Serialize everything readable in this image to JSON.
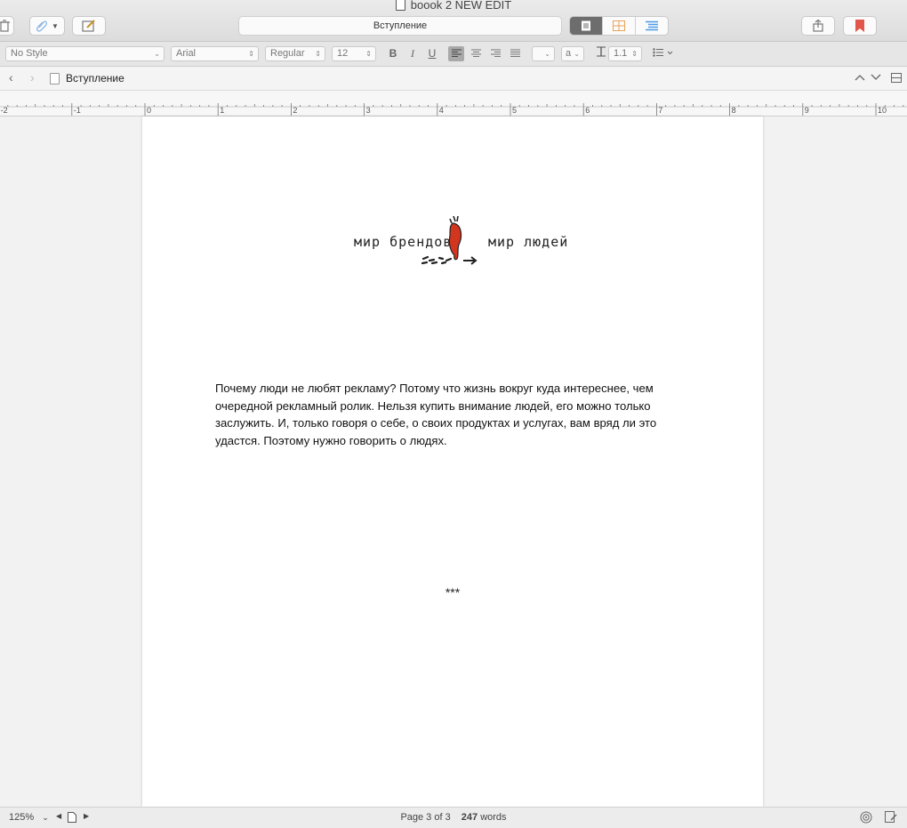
{
  "window": {
    "title": "boook 2 NEW EDIT"
  },
  "toolbar": {
    "document_title": "Вступление",
    "icons": [
      "trash-icon",
      "paperclip-icon",
      "compose-icon",
      "single-page-view-icon",
      "corkboard-grid-icon",
      "outline-list-icon",
      "share-icon",
      "bookmark-icon"
    ],
    "bookmark_color": "#e2574c",
    "outline_icon_color": "#4a9be8",
    "corkboard_icon_color": "#e8a35a"
  },
  "format_bar": {
    "style": "No Style",
    "font": "Arial",
    "weight": "Regular",
    "size": "12",
    "bold": "B",
    "italic": "I",
    "underline": "U",
    "highlight_label": "a",
    "line_spacing": "1.1"
  },
  "navigation": {
    "breadcrumb": "Вступление"
  },
  "ruler": {
    "labels": [
      "-2",
      "-1",
      "0",
      "1",
      "2",
      "3",
      "4",
      "5",
      "6",
      "7",
      "8",
      "9",
      "10"
    ]
  },
  "document": {
    "illustration": {
      "left_caption": "мир брендов",
      "right_caption": "мир людей",
      "accent_color": "#d2361f"
    },
    "paragraph_lines": [
      "Почему люди не любят рекламу? Потому что жизнь вокруг куда интереснее, чем",
      "очередной рекламный ролик. Нельзя купить внимание людей, его можно только",
      "заслужить. И, только говоря о себе, о своих продуктах и услугах, вам вряд ли это",
      "удастся. Поэтому нужно говорить о людях."
    ],
    "separator": "***"
  },
  "status_bar": {
    "zoom": "125%",
    "page_info": "Page 3 of 3",
    "word_count": "247",
    "words_label": "words"
  }
}
